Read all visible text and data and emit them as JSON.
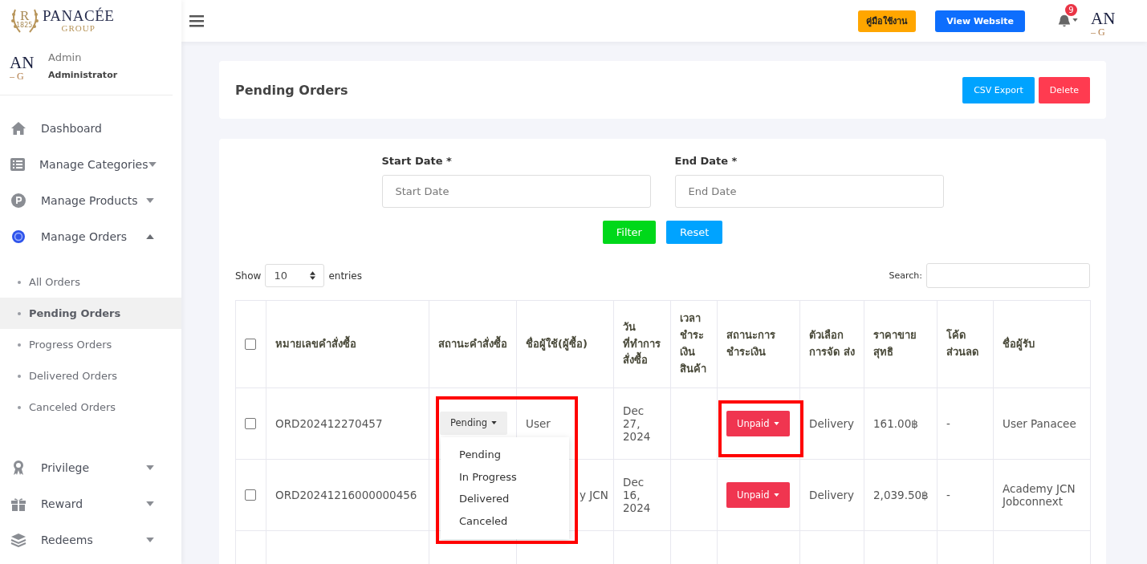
{
  "brand": {
    "emblem_letter": "R",
    "emblem_year": "1825",
    "name": "PANACÉE",
    "sub": "GROUP"
  },
  "header": {
    "manual_button": "คู่มือใช้งาน",
    "website_button": "View Website",
    "notification_count": "9",
    "avatar_top": "AN",
    "avatar_bottom": "– G"
  },
  "user": {
    "avatar_top": "AN",
    "avatar_bottom": "– G",
    "name": "Admin",
    "role": "Administrator"
  },
  "sidebar": {
    "items": [
      {
        "label": "Dashboard",
        "kind": "link"
      },
      {
        "label": "Manage Categories",
        "kind": "menu",
        "expanded": false
      },
      {
        "label": "Manage Products",
        "kind": "menu",
        "expanded": false
      },
      {
        "label": "Manage Orders",
        "kind": "menu",
        "expanded": true,
        "children": [
          {
            "label": "All Orders",
            "selected": false
          },
          {
            "label": "Pending Orders",
            "selected": true
          },
          {
            "label": "Progress Orders",
            "selected": false
          },
          {
            "label": "Delivered Orders",
            "selected": false
          },
          {
            "label": "Canceled Orders",
            "selected": false
          }
        ]
      },
      {
        "label": "Privilege",
        "kind": "menu",
        "expanded": false
      },
      {
        "label": "Reward",
        "kind": "menu",
        "expanded": false
      },
      {
        "label": "Redeems",
        "kind": "menu",
        "expanded": false
      }
    ]
  },
  "page": {
    "title": "Pending Orders",
    "buttons": [
      "CSV Export",
      "Delete"
    ]
  },
  "filters": {
    "start_label": "Start Date *",
    "start_placeholder": "Start Date",
    "end_label": "End Date *",
    "end_placeholder": "End Date",
    "filter_button": "Filter",
    "reset_button": "Reset"
  },
  "table_controls": {
    "show": "Show",
    "page_size": "10",
    "entries": "entries",
    "search": "Search:"
  },
  "table": {
    "select_all": false,
    "columns": [
      "หมายเลขคำสั่งซื้อ",
      "สถานะคำสั่งซื้อ",
      "ชื่อผู้ใช้(ผู้ซื้อ)",
      "วัน ที่ทำการ สั่งซื้อ",
      "เวลา ชำระ เงิน สินค้า",
      "สถานะการ ชำระเงิน",
      "ตัวเลือก การจัด ส่ง",
      "ราคาขาย สุทธิ",
      "โค้ด ส่วนลด",
      "ชื่อผู้รับ"
    ],
    "rows": [
      {
        "checked": false,
        "order": "ORD202412270457",
        "status": "Pending",
        "buyer": "User",
        "date": "Dec 27, 2024",
        "payment": "Unpaid",
        "delivery": "Delivery",
        "price": "161.00฿",
        "code": "-",
        "recipient": "User Panacee"
      },
      {
        "checked": false,
        "order": "ORD20241216000000456",
        "buyer": "y JCN",
        "date": "Dec 16, 2024",
        "payment": "Unpaid",
        "delivery": "Delivery",
        "price": "2,039.50฿",
        "code": "-",
        "recipient": "Academy JCN Jobconnext"
      }
    ]
  },
  "status_menu": {
    "open": true,
    "options": [
      "Pending",
      "In Progress",
      "Delivered",
      "Canceled"
    ]
  }
}
